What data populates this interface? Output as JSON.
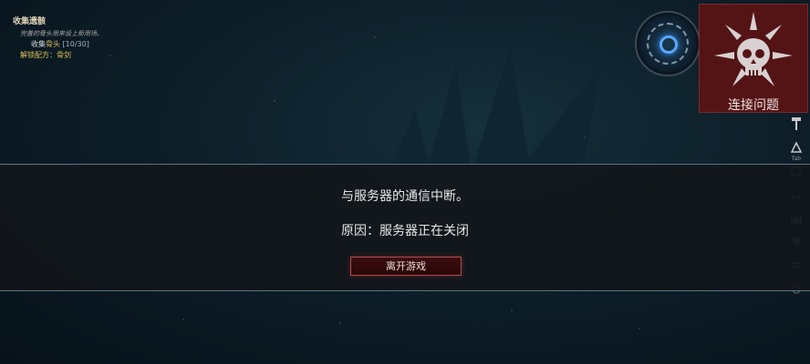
{
  "quest": {
    "title": "收集遗骸",
    "description": "完善的骨头用来设上新用场。",
    "progress_prefix": "收集",
    "progress_item": "骨头",
    "progress_count": "[10/30]",
    "unlock_text": "解锁配方：骨剑"
  },
  "connection_issue": {
    "label": "连接问题",
    "icon": "skull-icon",
    "color": "#541416"
  },
  "hotkeys": [
    {
      "icon": "hammer-icon",
      "key": ""
    },
    {
      "icon": "map-icon",
      "key": "Tab"
    },
    {
      "icon": "clock-icon",
      "key": ""
    },
    {
      "icon": "bat-icon",
      "key": ""
    },
    {
      "icon": "castle-icon",
      "key": ""
    },
    {
      "icon": "armor-icon",
      "key": ""
    },
    {
      "icon": "menu-icon",
      "key": "Escape"
    },
    {
      "icon": "help-icon",
      "key": ""
    }
  ],
  "dialog": {
    "message": "与服务器的通信中断。",
    "reason": "原因：服务器正在关闭",
    "leave_button": "离开游戏"
  },
  "colors": {
    "button_border": "#b24c4f",
    "quest_highlight": "#d9b75a",
    "compass_glow": "#5aa8ff"
  }
}
